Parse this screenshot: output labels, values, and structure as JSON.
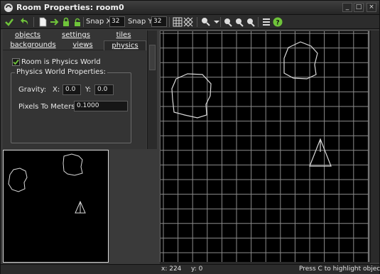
{
  "window": {
    "title": "Room Properties: room0",
    "controls": [
      "_",
      "□",
      "×"
    ]
  },
  "toolbar": {
    "snap_x_label": "Snap X",
    "snap_x_value": "32",
    "snap_y_label": "Snap Y",
    "snap_y_value": "32",
    "icons": [
      "confirm-check-icon",
      "undo-icon",
      "new-room-icon",
      "shift-icon",
      "lock-icon",
      "unlock-icon",
      "grid-icon",
      "isometric-grid-icon",
      "zoom-icon",
      "zoom-out-icon",
      "zoom-reset-icon",
      "zoom-in-icon",
      "list-icon",
      "help-icon"
    ]
  },
  "tabs": {
    "row1": [
      "objects",
      "settings",
      "tiles"
    ],
    "row2": [
      "backgrounds",
      "views",
      "physics"
    ],
    "active": "physics"
  },
  "physics": {
    "room_is_physics_world_label": "Room is Physics World",
    "room_is_physics_world_checked": true,
    "group_title": "Physics World Properties:",
    "gravity_label": "Gravity:",
    "gravity_x_label": "X:",
    "gravity_x_value": "0.0",
    "gravity_y_label": "Y:",
    "gravity_y_value": "0.0",
    "pixels_to_meters_label": "Pixels To Meters:",
    "pixels_to_meters_value": "0.1000"
  },
  "status": {
    "x": "x: 224",
    "y": "y: 0",
    "hint": "Press C to highlight objects o"
  },
  "colors": {
    "accent_green": "#6fc43a",
    "grid_line": "#8c8c8c",
    "shape_line": "#d9d9d9"
  }
}
